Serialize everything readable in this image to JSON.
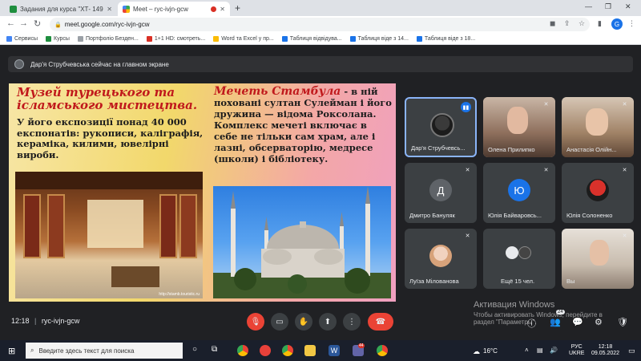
{
  "browser": {
    "tabs": [
      {
        "label": "Задания для курса \"ХТ- 149 ФЗ...",
        "active": false
      },
      {
        "label": "Meet – ryc-ivjn-gcw",
        "active": true
      }
    ],
    "url": "meet.google.com/ryc-ivjn-gcw",
    "profile_initial": "G",
    "bookmarks": [
      "Сервисы",
      "Курсы",
      "Портфоліо Безден...",
      "1+1 HD: смотреть...",
      "Word та Excel у пр...",
      "Таблиця відвідува...",
      "Таблиця віде з 14...",
      "Таблиця віде з 18..."
    ]
  },
  "meet": {
    "presenter_text": "Дар'я Струбчевська сейчас на главном экране",
    "meeting_code": "ryc-ivjn-gcw",
    "time": "12:18",
    "participants": [
      {
        "name": "Дар'я Струбчевсь...",
        "avatar": "photo",
        "speaking": true
      },
      {
        "name": "Олена Прилипко",
        "avatar": "photo",
        "mic_off": true
      },
      {
        "name": "Анастасія Олійн...",
        "avatar": "photo",
        "mic_off": true
      },
      {
        "name": "Дмитро Бануляк",
        "avatar": "letter",
        "letter": "Д",
        "color": "#5f6368",
        "mic_off": true
      },
      {
        "name": "Юлія Байваровсь...",
        "avatar": "letter",
        "letter": "Ю",
        "color": "#1a73e8",
        "mic_off": true
      },
      {
        "name": "Юлія Солоненко",
        "avatar": "photo",
        "mic_off": true
      },
      {
        "name": "Луїза Міловaнова",
        "avatar": "photo",
        "mic_off": true
      },
      {
        "name": "Ещё 15 чел.",
        "avatar": "group"
      },
      {
        "name": "Вы",
        "avatar": "photo",
        "mic_off": true
      }
    ],
    "people_badge": "24"
  },
  "slide": {
    "left_title": "Музей турецького та ісламського мистецтва.",
    "left_body": "У його експозиції понад 40 000 експонатів: рукописи, каліграфія, кераміка, килими, ювелірні вироби.",
    "right_title": "Мечеть Стамбула",
    "right_body": " - в ній поховані султан Сулейман і його дружина — відома Роксолана. Комплекс мечеті включає в себе не тільки сам храм, але і лазні, обсерваторію, медресе (школи) і бібліотеку.",
    "img_caption": "http://stamb.touristic.ru"
  },
  "watermark": {
    "title": "Активация Windows",
    "line1": "Чтобы активировать Windows, перейдите в",
    "line2": "раздел \"Параметры\"."
  },
  "taskbar": {
    "search_placeholder": "Введите здесь текст для поиска",
    "weather": "16°C",
    "lang": "РУС",
    "lang2": "UKRE",
    "clock_time": "12:18",
    "clock_date": "09.05.2022",
    "notif_count": "44"
  }
}
